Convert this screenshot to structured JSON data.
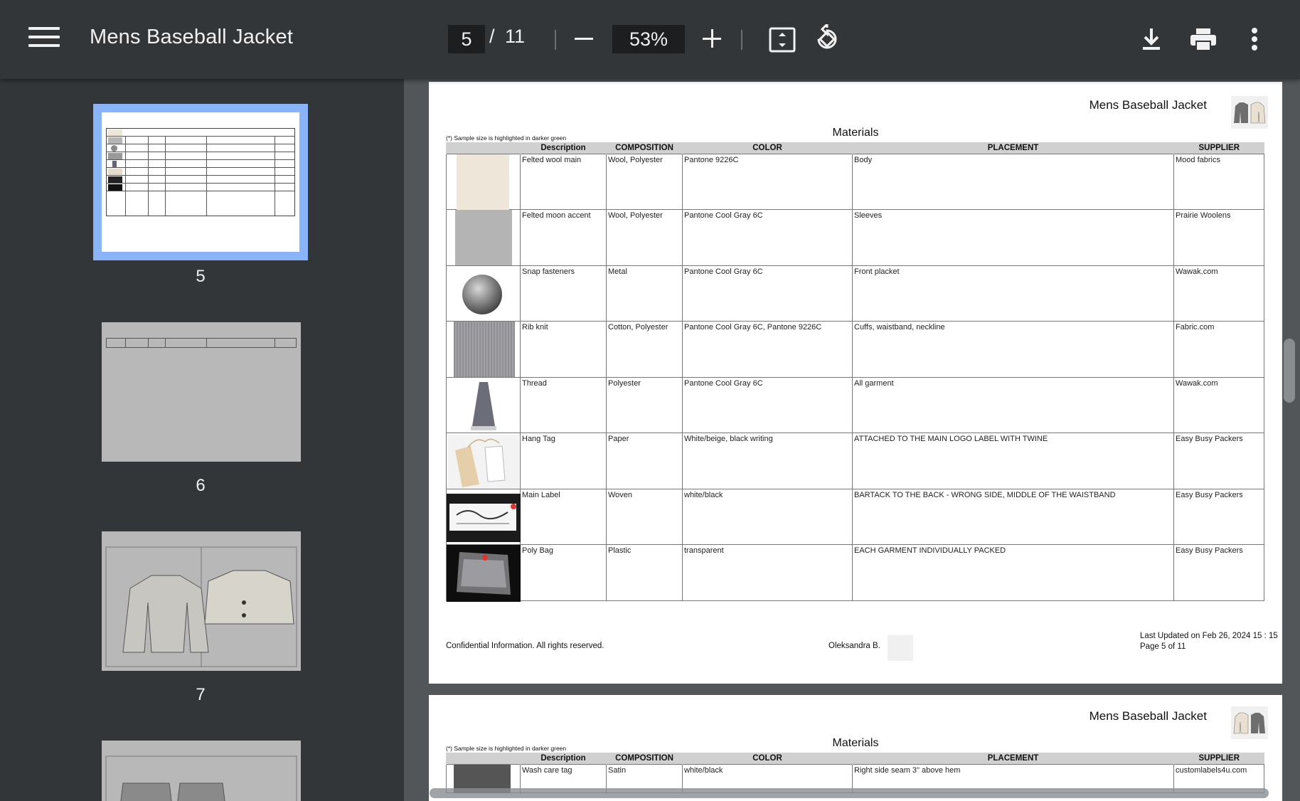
{
  "toolbar": {
    "title": "Mens Baseball Jacket",
    "current_page": "5",
    "separator": "/",
    "total_pages": "11",
    "zoom": "53%"
  },
  "sidebar": {
    "thumbnails": [
      {
        "label": "5"
      },
      {
        "label": "6"
      },
      {
        "label": "7"
      }
    ]
  },
  "document": {
    "header_title": "Mens Baseball Jacket",
    "sample_note": "(*) Sample size is highlighted in darker green",
    "section_title": "Materials",
    "columns": [
      "Description",
      "COMPOSITION",
      "COLOR",
      "PLACEMENT",
      "SUPPLIER"
    ],
    "rows": [
      {
        "description": "Felted wool main",
        "composition": "Wool, Polyester",
        "color": "Pantone 9226C",
        "placement": "Body",
        "supplier": "Mood fabrics"
      },
      {
        "description": "Felted moon accent",
        "composition": "Wool, Polyester",
        "color": "Pantone Cool Gray 6C",
        "placement": "Sleeves",
        "supplier": "Prairie Woolens"
      },
      {
        "description": "Snap fasteners",
        "composition": "Metal",
        "color": "Pantone Cool Gray 6C",
        "placement": "Front placket",
        "supplier": "Wawak.com"
      },
      {
        "description": "Rib knit",
        "composition": "Cotton, Polyester",
        "color": "Pantone Cool Gray 6C, Pantone 9226C",
        "placement": "Cuffs, waistband, neckline",
        "supplier": "Fabric.com"
      },
      {
        "description": "Thread",
        "composition": "Polyester",
        "color": "Pantone Cool Gray 6C",
        "placement": "All garment",
        "supplier": "Wawak.com"
      },
      {
        "description": "Hang Tag",
        "composition": "Paper",
        "color": "White/beige, black writing",
        "placement": "ATTACHED TO THE MAIN LOGO LABEL WITH TWINE",
        "supplier": "Easy Busy Packers"
      },
      {
        "description": "Main Label",
        "composition": "Woven",
        "color": "white/black",
        "placement": "BARTACK TO THE BACK - WRONG SIDE, MIDDLE OF THE WAISTBAND",
        "supplier": "Easy Busy Packers"
      },
      {
        "description": "Poly Bag",
        "composition": "Plastic",
        "color": "transparent",
        "placement": "EACH GARMENT INDIVIDUALLY PACKED",
        "supplier": "Easy Busy Packers"
      }
    ],
    "footer_left": "Confidential Information. All rights reserved.",
    "footer_author": "Oleksandra B.",
    "footer_updated": "Last Updated on Feb 26, 2024 15 : 15",
    "footer_page": "Page 5 of 11"
  },
  "next_page": {
    "header_title": "Mens Baseball Jacket",
    "sample_note": "(*) Sample size is highlighted in darker green",
    "section_title": "Materials",
    "columns": [
      "Description",
      "COMPOSITION",
      "COLOR",
      "PLACEMENT",
      "SUPPLIER"
    ],
    "first_row": {
      "description": "Wash care tag",
      "composition": "Satin",
      "color": "white/black",
      "placement": "Right side seam 3\" above hem",
      "supplier": "customlabels4u.com"
    }
  },
  "colors": {
    "toolbar_bg": "#323639",
    "viewer_bg": "#525659",
    "selected_thumb": "#8ab4f8"
  },
  "icons": [
    "menu-icon",
    "fit-page-icon",
    "rotate-icon",
    "download-icon",
    "print-icon",
    "more-vert-icon"
  ]
}
